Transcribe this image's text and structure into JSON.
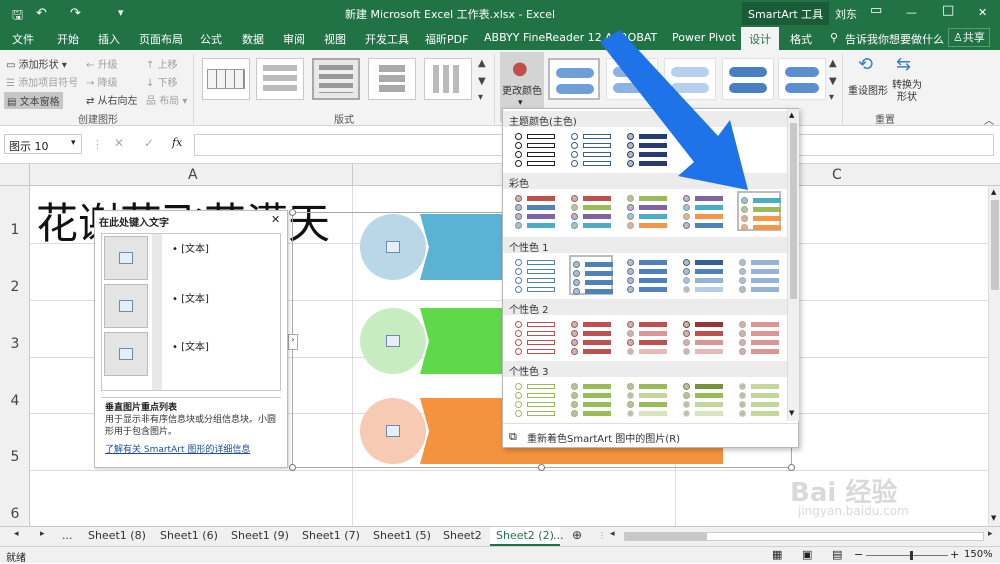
{
  "window": {
    "title": "新建 Microsoft Excel 工作表.xlsx  -  Excel",
    "context_tab": "SmartArt 工具",
    "user": "刘东",
    "controls": [
      "—",
      "□",
      "✕"
    ]
  },
  "ribbon_tabs": [
    {
      "label": "文件"
    },
    {
      "label": "开始"
    },
    {
      "label": "插入"
    },
    {
      "label": "页面布局"
    },
    {
      "label": "公式"
    },
    {
      "label": "数据"
    },
    {
      "label": "审阅"
    },
    {
      "label": "视图"
    },
    {
      "label": "开发工具"
    },
    {
      "label": "福昕PDF"
    },
    {
      "label": "ABBYY FineReader 12"
    },
    {
      "label": "ACROBAT"
    },
    {
      "label": "Power Pivot"
    },
    {
      "label": "设计"
    },
    {
      "label": "格式"
    }
  ],
  "tell_me": "告诉我你想要做什么",
  "share": "共享",
  "create_graphic": {
    "add_shape": "添加形状",
    "add_bullet": "添加项目符号",
    "text_pane": "文本窗格",
    "promote": "升级",
    "demote": "降级",
    "rtl": "从右向左",
    "move_up": "上移",
    "move_down": "下移",
    "layout": "布局",
    "group_label": "创建图形"
  },
  "layouts_label": "版式",
  "change_colors": "更改颜色",
  "reset": {
    "reset_graphic": "重设图形",
    "convert": "转换为形状",
    "group_label": "重置"
  },
  "name_box": "图示 10",
  "fx": "fx",
  "columns": [
    "A",
    "B",
    "C"
  ],
  "rows": [
    "1",
    "2",
    "3",
    "4",
    "5",
    "6"
  ],
  "cell_text": "花谢花飞花满天",
  "text_pane": {
    "title": "在此处键入文字",
    "bullets": [
      "[文本]",
      "[文本]",
      "[文本]"
    ],
    "desc_title": "垂直图片重点列表",
    "desc": "用于显示非有序信息块或分组信息块。小圆形用于包含图片。",
    "link": "了解有关 SmartArt 图形的详细信息"
  },
  "smartart_colors": {
    "c1": "#b9d7e6",
    "c2": "#c6ecc0",
    "c3": "#f7cbb3",
    "h1": "#5bb3d4",
    "h2": "#5fd94a",
    "h3": "#f5923e"
  },
  "gallery": {
    "sections": [
      "主题颜色(主色)",
      "彩色",
      "个性色 1",
      "个性色 2",
      "个性色 3"
    ],
    "footer": "重新着色SmartArt 图中的图片(R)"
  },
  "sheets": [
    "Sheet1 (8)",
    "Sheet1 (6)",
    "Sheet1 (9)",
    "Sheet1 (7)",
    "Sheet1 (5)",
    "Sheet2",
    "Sheet2 (2)"
  ],
  "sheet_more": "...",
  "status": {
    "ready": "就绪",
    "zoom": "150%"
  },
  "watermark": {
    "logo": "Bai 经验",
    "url": "jingyan.baidu.com"
  }
}
